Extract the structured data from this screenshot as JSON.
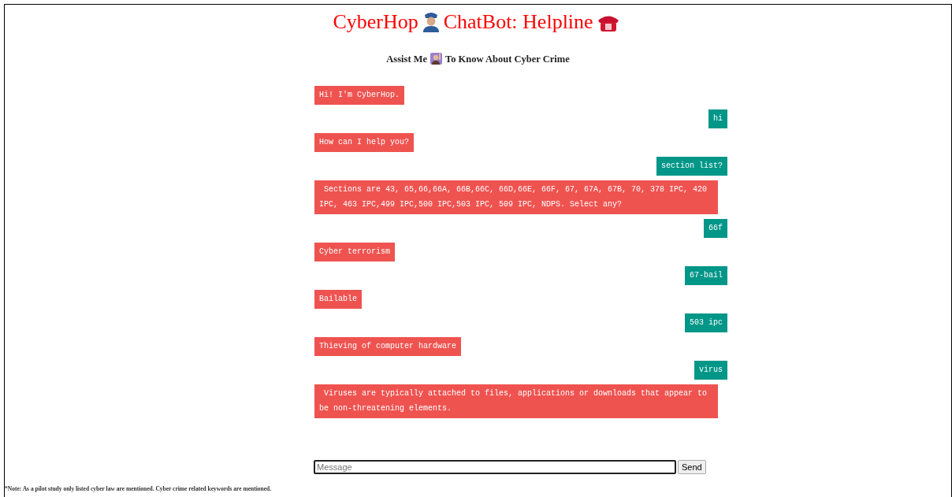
{
  "header": {
    "title_parts": [
      "CyberHop",
      "ChatBot: Helpline"
    ],
    "subtitle_parts": [
      "Assist Me",
      "To Know About Cyber Crime"
    ]
  },
  "messages": [
    {
      "kind": "bot",
      "text": "Hi! I'm CyberHop."
    },
    {
      "kind": "user",
      "text": "hi"
    },
    {
      "kind": "bot",
      "text": "How can I help you?"
    },
    {
      "kind": "user",
      "text": "section list?"
    },
    {
      "kind": "bot",
      "text": " Sections are 43, 65,66,66A, 66B,66C, 66D,66E, 66F, 67, 67A, 67B, 70, 378 IPC, 420 IPC, 463 IPC,499 IPC,500 IPC,503 IPC, 509 IPC, NDPS. Select any?"
    },
    {
      "kind": "user",
      "text": "66f"
    },
    {
      "kind": "bot",
      "text": "Cyber terrorism"
    },
    {
      "kind": "user",
      "text": "67-bail"
    },
    {
      "kind": "bot",
      "text": "Bailable"
    },
    {
      "kind": "user",
      "text": "503 ipc"
    },
    {
      "kind": "bot",
      "text": "Thieving of computer hardware"
    },
    {
      "kind": "user",
      "text": "virus"
    },
    {
      "kind": "bot",
      "text": " Viruses are typically attached to files, applications or downloads that appear to be non-threatening elements."
    }
  ],
  "composer": {
    "placeholder": "Message",
    "button": "Send"
  },
  "note": "*Note: As a pilot study only listed cyber law are mentioned. Cyber crime related keywords are mentioned."
}
